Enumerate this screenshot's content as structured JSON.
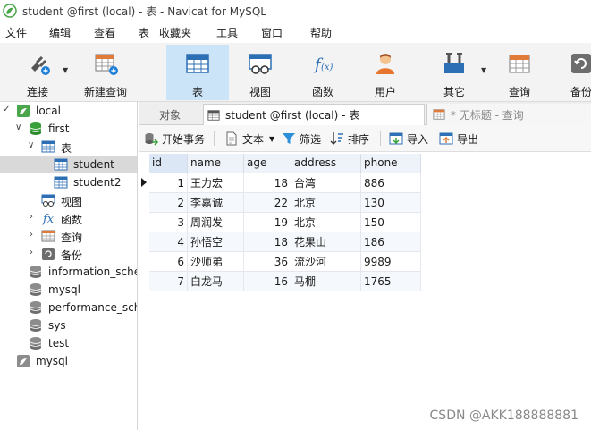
{
  "window": {
    "title": "student @first (local) - 表 - Navicat for MySQL"
  },
  "menu": [
    "文件",
    "编辑",
    "查看",
    "表",
    "收藏夹",
    "工具",
    "窗口",
    "帮助"
  ],
  "toolbar": {
    "items": [
      {
        "label": "连接",
        "icon": "connection-icon"
      },
      {
        "label": "新建查询",
        "icon": "new-query-icon"
      },
      {
        "label": "表",
        "icon": "table-icon"
      },
      {
        "label": "视图",
        "icon": "view-icon"
      },
      {
        "label": "函数",
        "icon": "function-icon"
      },
      {
        "label": "用户",
        "icon": "user-icon"
      },
      {
        "label": "其它",
        "icon": "tools-icon"
      },
      {
        "label": "查询",
        "icon": "query-icon"
      },
      {
        "label": "备份",
        "icon": "backup-icon"
      }
    ]
  },
  "sidebar": {
    "tree": [
      {
        "label": "local",
        "level": 0,
        "icon": "connection-icon",
        "expanded": true
      },
      {
        "label": "first",
        "level": 1,
        "icon": "database-icon",
        "expanded": true
      },
      {
        "label": "表",
        "level": 2,
        "icon": "table-icon",
        "expanded": true
      },
      {
        "label": "student",
        "level": 3,
        "icon": "table-icon",
        "selected": true
      },
      {
        "label": "student2",
        "level": 3,
        "icon": "table-icon"
      },
      {
        "label": "视图",
        "level": 2,
        "icon": "view-icon"
      },
      {
        "label": "函数",
        "level": 2,
        "icon": "function-icon",
        "collapsed": true
      },
      {
        "label": "查询",
        "level": 2,
        "icon": "query-icon",
        "collapsed": true
      },
      {
        "label": "备份",
        "level": 2,
        "icon": "backup-icon",
        "collapsed": true
      },
      {
        "label": "information_sche",
        "level": 1,
        "icon": "database-icon"
      },
      {
        "label": "mysql",
        "level": 1,
        "icon": "database-icon"
      },
      {
        "label": "performance_sch",
        "level": 1,
        "icon": "database-icon"
      },
      {
        "label": "sys",
        "level": 1,
        "icon": "database-icon"
      },
      {
        "label": "test",
        "level": 1,
        "icon": "database-icon"
      },
      {
        "label": "mysql",
        "level": 0,
        "icon": "connection-icon"
      }
    ]
  },
  "tabs": {
    "objects": "对象",
    "table": "student @first (local) - 表",
    "query": "* 无标题 - 查询"
  },
  "actions": {
    "begin_transaction": "开始事务",
    "text": "文本",
    "filter": "筛选",
    "sort": "排序",
    "import": "导入",
    "export": "导出"
  },
  "table": {
    "columns": [
      "id",
      "name",
      "age",
      "address",
      "phone"
    ],
    "rows": [
      [
        "1",
        "王力宏",
        "18",
        "台湾",
        "886"
      ],
      [
        "2",
        "李嘉诚",
        "22",
        "北京",
        "130"
      ],
      [
        "3",
        "周润发",
        "19",
        "北京",
        "150"
      ],
      [
        "4",
        "孙悟空",
        "18",
        "花果山",
        "186"
      ],
      [
        "6",
        "沙师弟",
        "36",
        "流沙河",
        "9989"
      ],
      [
        "7",
        "白龙马",
        "16",
        "马棚",
        "1765"
      ]
    ]
  },
  "watermark": "CSDN @AKK188888881",
  "colors": {
    "accent": "#cce4f7",
    "selected_row": "#d9d9d9",
    "header": "#eef3fa"
  }
}
